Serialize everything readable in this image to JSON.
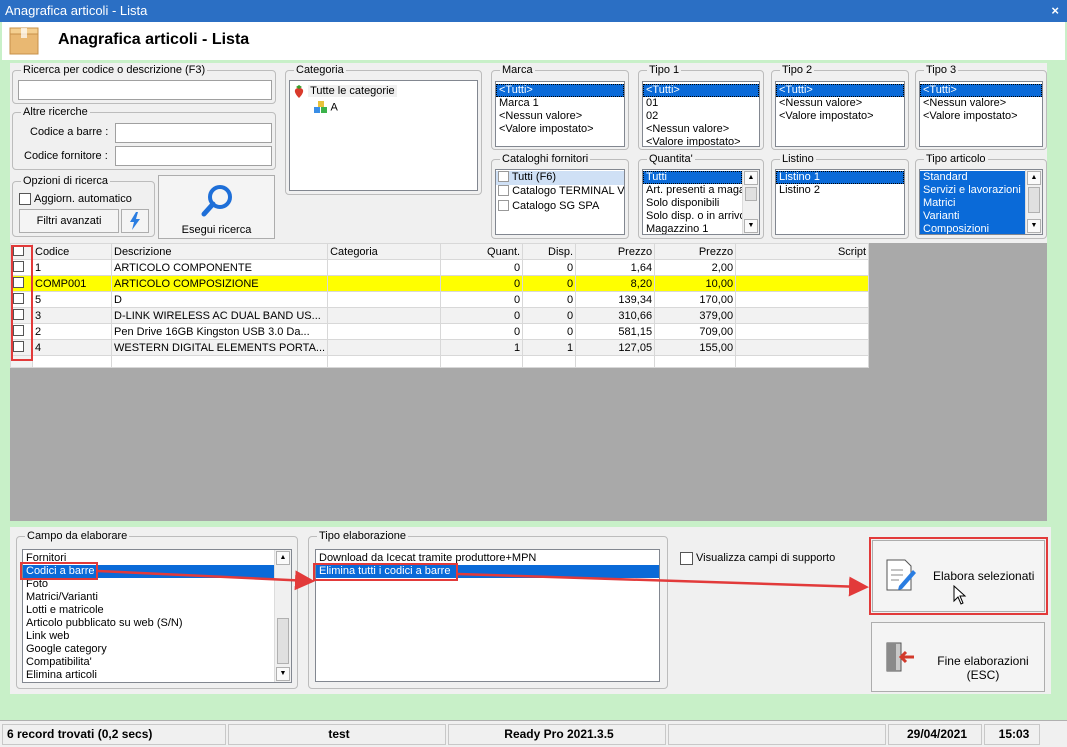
{
  "window": {
    "title": "Anagrafica articoli  - Lista",
    "header_title": "Anagrafica articoli  - Lista",
    "close_glyph": "×"
  },
  "search": {
    "group_title": "Ricerca per codice o descrizione (F3)",
    "value": "",
    "other_title": "Altre ricerche",
    "barcode_label": "Codice a barre :",
    "supplier_label": "Codice fornitore :",
    "options_title": "Opzioni di ricerca",
    "auto_update_label": "Aggiorn. automatico",
    "advanced_filters_label": "Filtri avanzati",
    "search_button_label": "Esegui ricerca"
  },
  "categoria": {
    "title": "Categoria",
    "root": "Tutte le categorie",
    "child": "A"
  },
  "marca": {
    "title": "Marca",
    "items": [
      "<Tutti>",
      "Marca 1",
      "<Nessun valore>",
      "<Valore impostato>"
    ],
    "selected": 0
  },
  "tipo1": {
    "title": "Tipo 1",
    "items": [
      "<Tutti>",
      "01",
      "02",
      "<Nessun valore>",
      "<Valore impostato>"
    ],
    "selected": 0
  },
  "tipo2": {
    "title": "Tipo 2",
    "items": [
      "<Tutti>",
      "<Nessun valore>",
      "<Valore impostato>"
    ],
    "selected": 0
  },
  "tipo3": {
    "title": "Tipo 3",
    "items": [
      "<Tutti>",
      "<Nessun valore>",
      "<Valore impostato>"
    ],
    "selected": 0
  },
  "cataloghi": {
    "title": "Cataloghi fornitori",
    "items": [
      "Tutti (F6)",
      "Catalogo TERMINAL VID",
      "Catalogo SG SPA"
    ],
    "selected": 0
  },
  "quantita": {
    "title": "Quantita'",
    "items": [
      "Tutti",
      "Art. presenti a magaz",
      "Solo disponibili",
      "Solo disp. o in arrivo",
      "Magazzino 1"
    ],
    "selected": 0
  },
  "listino": {
    "title": "Listino",
    "items": [
      "Listino 1",
      "Listino 2"
    ],
    "selected": 0
  },
  "tipo_articolo": {
    "title": "Tipo articolo",
    "items": [
      "Standard",
      "Servizi e lavorazioni",
      "Matrici",
      "Varianti",
      "Composizioni"
    ]
  },
  "grid": {
    "columns": [
      "Codice",
      "Descrizione",
      "Categoria",
      "Quant.",
      "Disp.",
      "Prezzo",
      "Prezzo",
      "Script"
    ],
    "rows": [
      {
        "codice": "1",
        "descrizione": "ARTICOLO COMPONENTE",
        "categoria": "",
        "quant": "0",
        "disp": "0",
        "prezzo1": "1,64",
        "prezzo2": "2,00",
        "script": ""
      },
      {
        "codice": "COMP001",
        "descrizione": "ARTICOLO COMPOSIZIONE",
        "categoria": "",
        "quant": "0",
        "disp": "0",
        "prezzo1": "8,20",
        "prezzo2": "10,00",
        "script": ""
      },
      {
        "codice": "5",
        "descrizione": "D",
        "categoria": "",
        "quant": "0",
        "disp": "0",
        "prezzo1": "139,34",
        "prezzo2": "170,00",
        "script": ""
      },
      {
        "codice": "3",
        "descrizione": "D-LINK WIRELESS AC DUAL BAND US...",
        "categoria": "",
        "quant": "0",
        "disp": "0",
        "prezzo1": "310,66",
        "prezzo2": "379,00",
        "script": ""
      },
      {
        "codice": "2",
        "descrizione": "Pen Drive 16GB  Kingston  USB 3.0 Da...",
        "categoria": "",
        "quant": "0",
        "disp": "0",
        "prezzo1": "581,15",
        "prezzo2": "709,00",
        "script": ""
      },
      {
        "codice": "4",
        "descrizione": "WESTERN DIGITAL ELEMENTS PORTA...",
        "categoria": "",
        "quant": "1",
        "disp": "1",
        "prezzo1": "127,05",
        "prezzo2": "155,00",
        "script": ""
      }
    ]
  },
  "campo": {
    "title": "Campo da elaborare",
    "items": [
      "Fornitori",
      "Codici a barre",
      "Foto",
      "Matrici/Varianti",
      "Lotti e matricole",
      "Articolo pubblicato su web (S/N)",
      "Link web",
      "Google category",
      "Compatibilita'",
      "Elimina articoli"
    ],
    "selected": 1
  },
  "tipo_elab": {
    "title": "Tipo elaborazione",
    "items": [
      "Download da Icecat tramite produttore+MPN",
      "Elimina tutti i codici a barre"
    ],
    "selected": 1
  },
  "visualizza_label": "Visualizza campi di supporto",
  "elabora_label": "Elabora selezionati",
  "fine_label": "Fine elaborazioni (ESC)",
  "status": {
    "records": "6 record trovati (0,2 secs)",
    "user": "test",
    "version": "Ready Pro 2021.3.5",
    "date": "29/04/2021",
    "time": "15:03"
  },
  "colors": {
    "accent": "#0a6ad8",
    "highlight_row": "#ffff00",
    "annotation": "#e23a3a",
    "background": "#c8f0c8"
  }
}
